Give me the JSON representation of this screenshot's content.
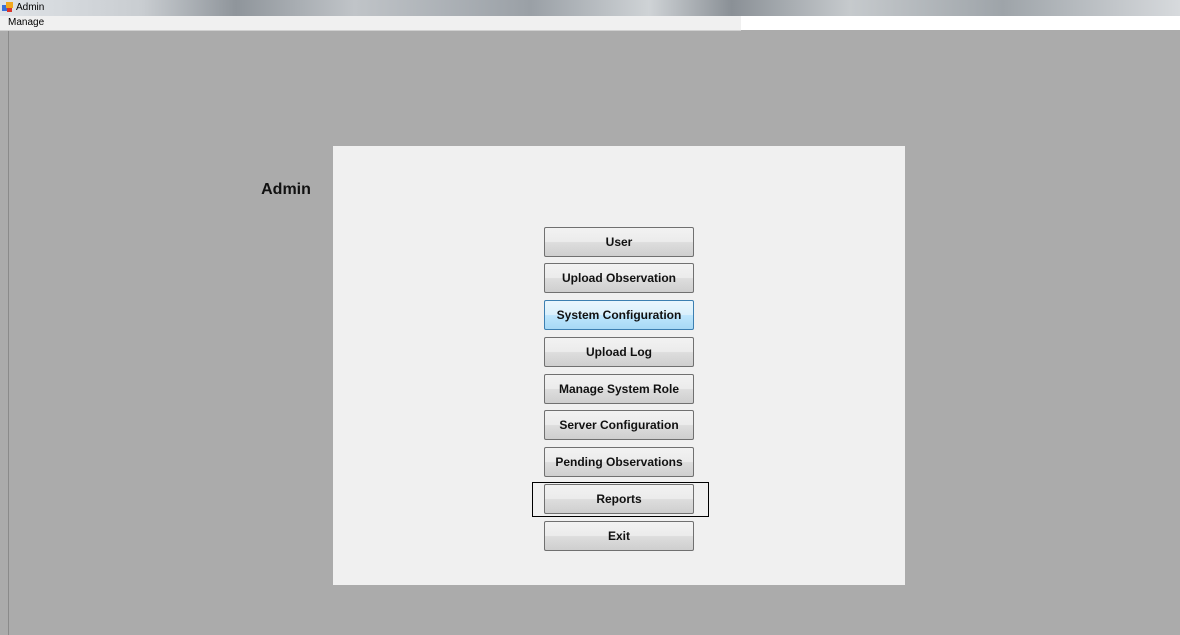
{
  "window": {
    "title": "Admin"
  },
  "menu": {
    "items": [
      {
        "label": "Manage"
      }
    ]
  },
  "panel": {
    "title": "Admin",
    "buttons": [
      {
        "label": "User"
      },
      {
        "label": "Upload Observation"
      },
      {
        "label": "System Configuration"
      },
      {
        "label": "Upload Log"
      },
      {
        "label": "Manage System Role"
      },
      {
        "label": "Server Configuration"
      },
      {
        "label": "Pending Observations"
      },
      {
        "label": "Reports"
      },
      {
        "label": "Exit"
      }
    ]
  },
  "colors": {
    "background": "#ababab",
    "panel": "#f0f0f0",
    "focus_border": "#3c7fb1"
  }
}
